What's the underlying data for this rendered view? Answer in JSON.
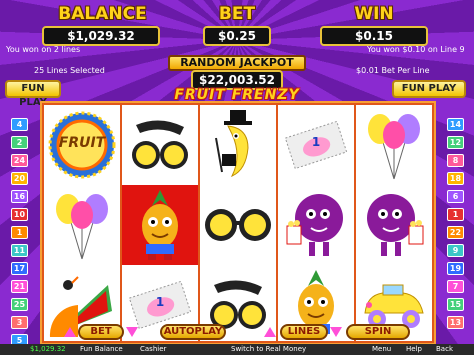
{
  "header": {
    "balance_label": "BALANCE",
    "balance_value": "$1,029.32",
    "bet_label": "BET",
    "bet_value": "$0.25",
    "win_label": "WIN",
    "win_value": "$0.15",
    "won_lines": "You won on 2 lines",
    "won_line9": "You won $0.10 on Line 9",
    "lines_selected": "25 Lines Selected",
    "bet_per_line": "$0.01 Bet Per Line",
    "jackpot_label": "RANDOM JACKPOT",
    "jackpot_value": "$22,003.52",
    "logo": "FRUIT FRENZY"
  },
  "fun_play_left": "FUN PLAY",
  "fun_play_right": "FUN PLAY",
  "line_numbers_left": [
    "4",
    "2",
    "24",
    "20",
    "16",
    "10",
    "1",
    "11",
    "17",
    "21",
    "25",
    "3",
    "5"
  ],
  "line_numbers_right": [
    "14",
    "12",
    "8",
    "18",
    "6",
    "1",
    "22",
    "9",
    "19",
    "7",
    "15",
    "13"
  ],
  "line_colors": [
    "#2f9cff",
    "#44d07a",
    "#ff5a9a",
    "#ffb400",
    "#a055ff",
    "#e63030",
    "#ff8a00",
    "#3bc7c7",
    "#c0ff3a",
    "#ff4fd8",
    "#2f6bff",
    "#9aff58",
    "#ff6e6e"
  ],
  "reels": [
    [
      "FRUIT",
      "balloons",
      "melon"
    ],
    [
      "glasses",
      "pineapple",
      "ticket"
    ],
    [
      "banana",
      "glasses",
      "glasses"
    ],
    [
      "ticket",
      "plum",
      "pineapple"
    ],
    [
      "balloons",
      "plum",
      "car"
    ]
  ],
  "jackpot_symbol_text": "FRUIT",
  "ticket_text": "1",
  "buttons": {
    "bet": "BET",
    "autoplay": "AUTOPLAY",
    "lines": "LINES",
    "spin": "SPIN"
  },
  "status_bar": {
    "balance": "$1,029.32",
    "fun_balance": "Fun Balance",
    "cashier": "Cashier",
    "switch": "Switch to Real Money",
    "menu": "Menu",
    "help": "Help",
    "back": "Back"
  }
}
